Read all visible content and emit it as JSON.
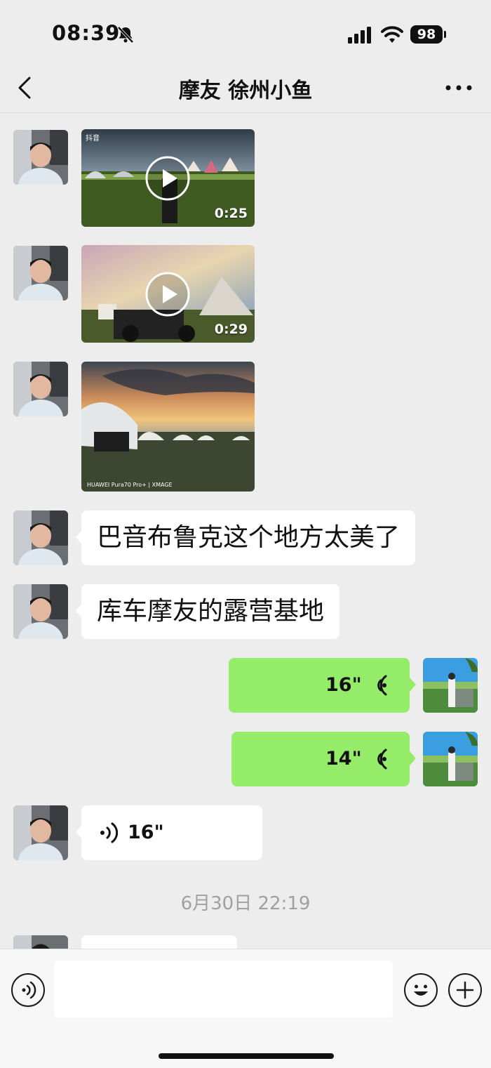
{
  "status": {
    "time": "08:39",
    "battery": "98",
    "bell_icon": "bell-muted-icon",
    "signal_icon": "cellular-signal-icon",
    "wifi_icon": "wifi-icon"
  },
  "nav": {
    "title": "摩友 徐州小鱼",
    "back_icon": "chevron-left-icon",
    "more_icon": "more-dots-icon"
  },
  "messages": [
    {
      "type": "video",
      "from": "contact",
      "duration": "0:25",
      "overlay_app": "抖音"
    },
    {
      "type": "video",
      "from": "contact",
      "duration": "0:29"
    },
    {
      "type": "image",
      "from": "contact",
      "watermark": "HUAWEI Pura70 Pro+ | XMAGE"
    },
    {
      "type": "text",
      "from": "contact",
      "text": "巴音布鲁克这个地方太美了"
    },
    {
      "type": "text",
      "from": "contact",
      "text": "库车摩友的露营基地"
    },
    {
      "type": "voice",
      "from": "me",
      "duration": "16\""
    },
    {
      "type": "voice",
      "from": "me",
      "duration": "14\""
    },
    {
      "type": "voice",
      "from": "contact",
      "duration": "16\""
    }
  ],
  "timestamp": "6月30日 22:19",
  "input_bar": {
    "voice_icon": "voice-mode-icon",
    "emoji_icon": "emoji-icon",
    "plus_icon": "plus-icon"
  },
  "colors": {
    "background": "#ededed",
    "self_bubble": "#95ec69",
    "contact_bubble": "#ffffff"
  }
}
